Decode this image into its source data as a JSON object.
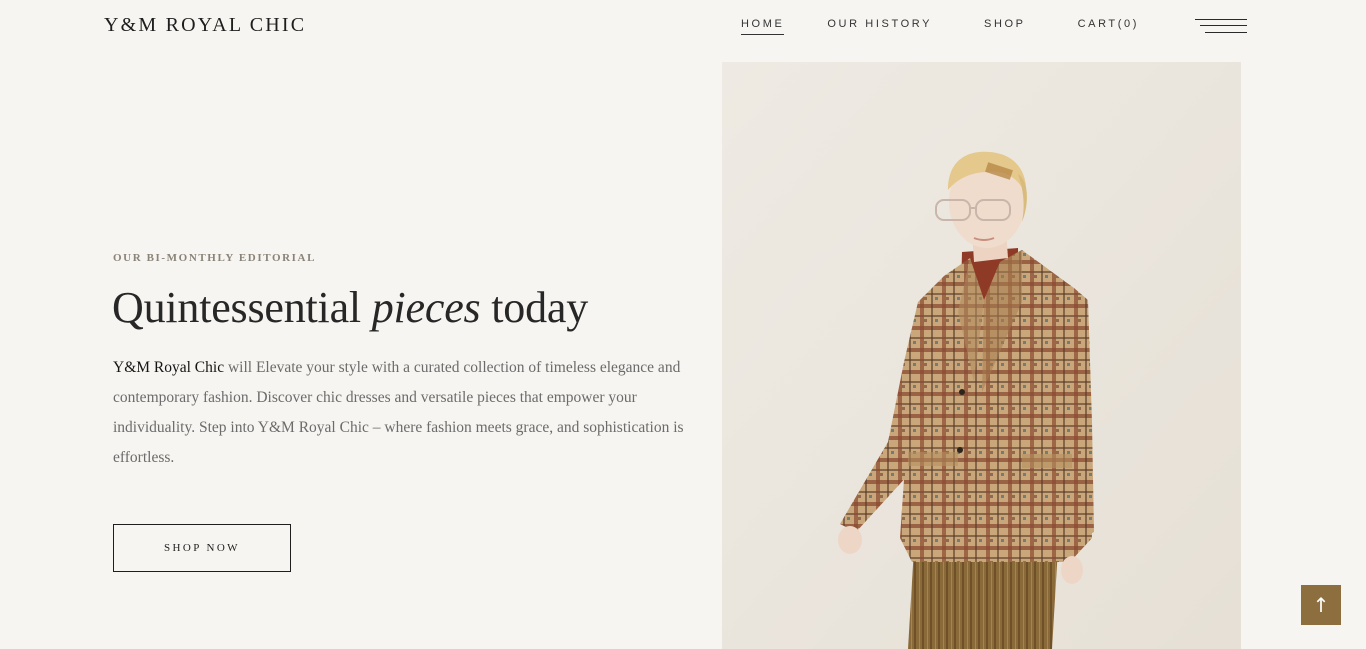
{
  "header": {
    "brand": "Y&M ROYAL CHIC",
    "nav": [
      {
        "label": "HOME",
        "active": true
      },
      {
        "label": "OUR HISTORY",
        "active": false
      },
      {
        "label": "SHOP",
        "active": false
      },
      {
        "label": "CART(0)",
        "active": false
      }
    ],
    "menu_icon": "hamburger-menu-icon"
  },
  "hero": {
    "eyebrow": "OUR BI-MONTHLY EDITORIAL",
    "headline": {
      "part1": "Quintessential ",
      "italic": "pieces",
      "part2": " today"
    },
    "description": {
      "brand": "Y&M Royal Chic",
      "text": " will Elevate your style with a curated collection of timeless elegance and contemporary fashion. Discover chic dresses and versatile pieces that empower your individuality. Step into Y&M Royal Chic – where fashion meets grace, and sophistication is effortless."
    },
    "cta_label": "SHOP NOW",
    "image_alt": "Model wearing a plaid blazer, red shirt and pleated skirt"
  },
  "back_to_top": {
    "icon": "arrow-up-icon",
    "glyph": "↑"
  },
  "colors": {
    "background": "#f7f5f1",
    "text": "#2b2b2b",
    "muted": "#6b6b6b",
    "accent": "#8d6f3f"
  }
}
